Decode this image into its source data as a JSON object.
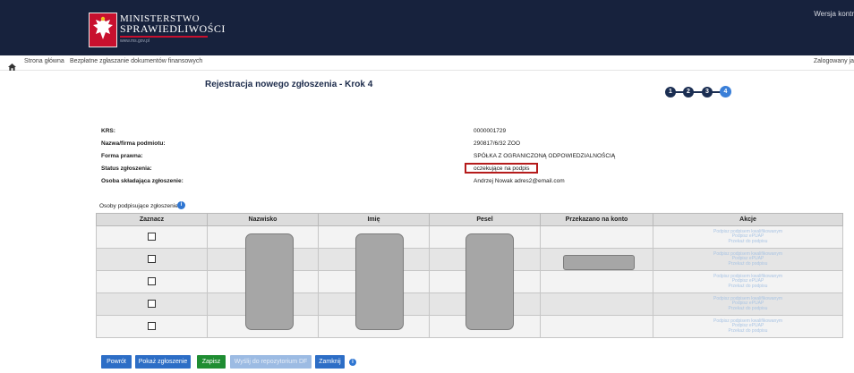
{
  "header": {
    "logo_line1": "MINISTERSTWO",
    "logo_line2": "SPRAWIEDLIWOŚCI",
    "logo_url": "www.ms.gov.pl",
    "version_text": "Wersja kontr"
  },
  "breadcrumb": {
    "home": "Strona główna",
    "current": "Bezpłatne zgłaszanie dokumentów finansowych",
    "logged_in": "Zalogowany ja"
  },
  "page": {
    "title": "Rejestracja nowego zgłoszenia - Krok 4",
    "steps": [
      "1",
      "2",
      "3",
      "4"
    ],
    "active_step": "4"
  },
  "details": [
    {
      "label": "KRS:",
      "value": "0000001729"
    },
    {
      "label": "Nazwa/firma podmiotu:",
      "value": "290817/6/32 ZOO"
    },
    {
      "label": "Forma prawna:",
      "value": "SPÓŁKA Z OGRANICZONĄ ODPOWIEDZIALNOŚCIĄ"
    },
    {
      "label": "Status zgłoszenia:",
      "value": "oczekujące na podpis"
    },
    {
      "label": "Osoba składająca zgłoszenie:",
      "value": "Andrzej Nowak adres2@email.com"
    }
  ],
  "signers": {
    "label": "Osoby podpisujące zgłoszenie",
    "columns": [
      "Zaznacz",
      "Nazwisko",
      "Imię",
      "Pesel",
      "Przekazano na konto",
      "Akcje"
    ],
    "actions": [
      "Podpisz podpisem kwalifikowanym",
      "Podpisz ePUAP",
      "Przekaż do podpisu"
    ],
    "row_count": 5
  },
  "buttons": {
    "back": "Powrót",
    "show": "Pokaż zgłoszenie",
    "save": "Zapisz",
    "send": "Wyślij do repozytorium DF",
    "close": "Zamknij"
  },
  "colors": {
    "header_bg": "#17223d",
    "accent_blue": "#2d6ec6",
    "save_green": "#1f8d32",
    "status_highlight": "#b51b1b"
  }
}
